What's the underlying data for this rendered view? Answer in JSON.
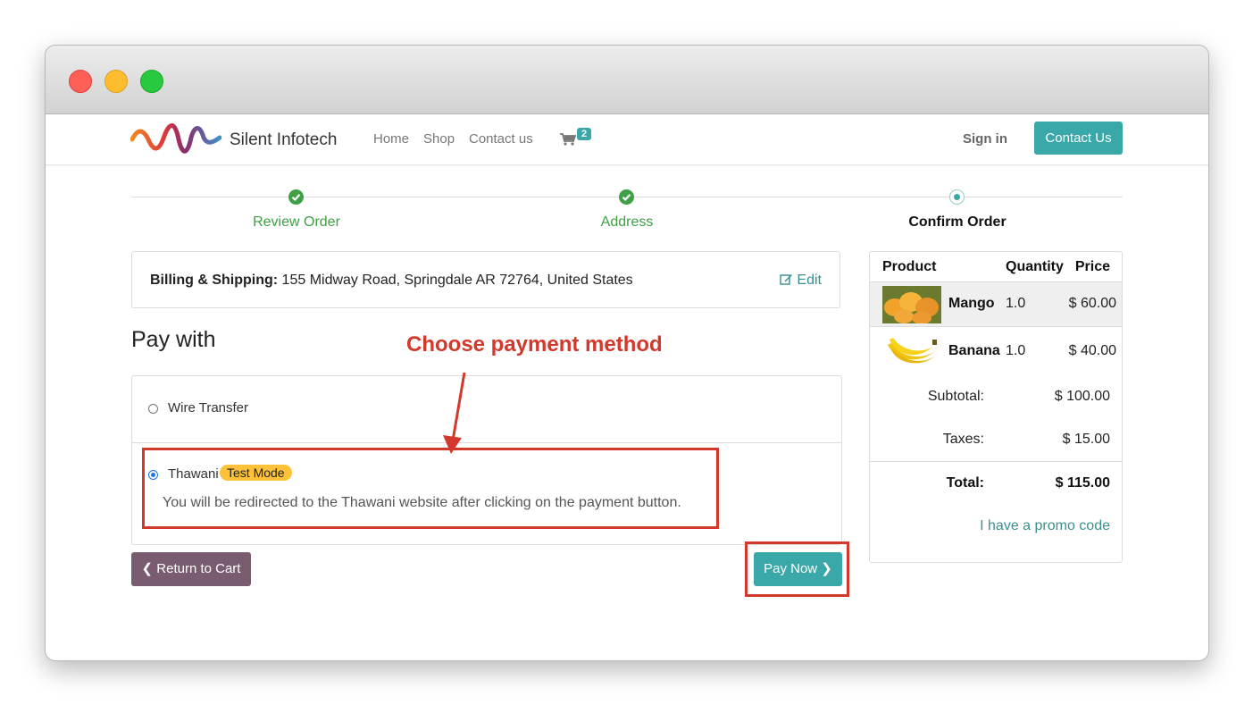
{
  "navbar": {
    "brand": "Silent Infotech",
    "links": [
      "Home",
      "Shop",
      "Contact us"
    ],
    "cart_count": "2",
    "signin": "Sign in",
    "contact_button": "Contact Us"
  },
  "steps": [
    {
      "label": "Review Order",
      "state": "done"
    },
    {
      "label": "Address",
      "state": "done"
    },
    {
      "label": "Confirm Order",
      "state": "current"
    }
  ],
  "billing": {
    "label": "Billing & Shipping:",
    "address": "155 Midway Road, Springdale AR 72764, United States",
    "edit": "Edit"
  },
  "payment": {
    "heading": "Pay with",
    "annotation": "Choose payment method",
    "options": [
      {
        "label": "Wire Transfer",
        "selected": false
      },
      {
        "label": "Thawani",
        "selected": true,
        "badge": "Test Mode",
        "description": "You will be redirected to the Thawani website after clicking on the payment button."
      }
    ],
    "return_button": "Return to Cart",
    "pay_button": "Pay Now"
  },
  "summary": {
    "headers": [
      "Product",
      "Quantity",
      "Price"
    ],
    "items": [
      {
        "name": "Mango",
        "quantity": "1.0",
        "price": "$ 60.00"
      },
      {
        "name": "Banana",
        "quantity": "1.0",
        "price": "$ 40.00"
      }
    ],
    "subtotal_label": "Subtotal:",
    "subtotal": "$ 100.00",
    "taxes_label": "Taxes:",
    "taxes": "$ 15.00",
    "total_label": "Total:",
    "total": "$ 115.00",
    "promo": "I have a promo code"
  },
  "colors": {
    "primary": "#3aa8a8",
    "success": "#3fa045",
    "secondary": "#7a5c70",
    "annotation": "#d2382b",
    "badge": "#fdc13a"
  }
}
